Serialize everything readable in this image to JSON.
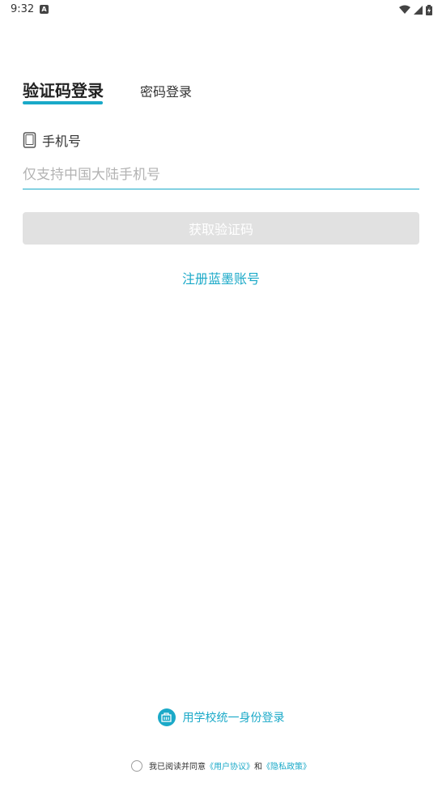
{
  "status_bar": {
    "time": "9:32",
    "notification_badge": "A"
  },
  "tabs": {
    "sms_login": "验证码登录",
    "password_login": "密码登录"
  },
  "phone": {
    "label": "手机号",
    "placeholder": "仅支持中国大陆手机号",
    "value": ""
  },
  "get_code_button": "获取验证码",
  "register_link": "注册蓝墨账号",
  "school_login": "用学校统一身份登录",
  "agreement": {
    "prefix": "我已阅读并同意",
    "user_agreement": "《用户协议》",
    "conjunction": "和",
    "privacy_policy": "《隐私政策》"
  },
  "colors": {
    "accent": "#1aa9c8",
    "button_disabled": "#e1e1e1"
  }
}
